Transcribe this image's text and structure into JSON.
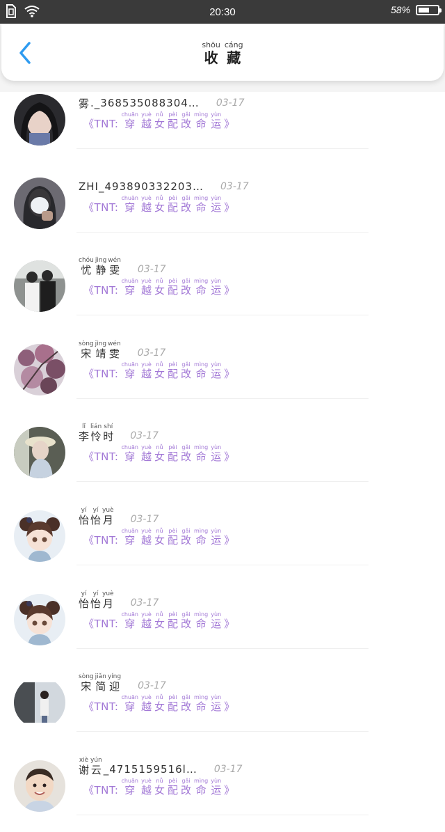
{
  "status_bar": {
    "time": "20:30",
    "battery": "58%",
    "battery_level": 0.58
  },
  "header": {
    "title": [
      {
        "py": "shōu",
        "hz": "收"
      },
      {
        "py": "cáng",
        "hz": "藏"
      }
    ]
  },
  "book": {
    "prefix": "《TNT:",
    "chars": [
      {
        "py": "chuān",
        "hz": "穿"
      },
      {
        "py": "yuè",
        "hz": "越"
      },
      {
        "py": "nǚ",
        "hz": "女"
      },
      {
        "py": "pèi",
        "hz": "配"
      },
      {
        "py": "gǎi",
        "hz": "改"
      },
      {
        "py": "mìng",
        "hz": "命"
      },
      {
        "py": "yùn",
        "hz": "运"
      }
    ],
    "suffix": "》"
  },
  "items": [
    {
      "name_chars": [
        {
          "py": "",
          "hz": "雾"
        }
      ],
      "name_plain": "._368535088304…",
      "date": "03-17",
      "avatar": "dark-hair-girl"
    },
    {
      "name_chars": [],
      "name_plain": "ZHI_493890332203…",
      "date": "03-17",
      "avatar": "masked-girl"
    },
    {
      "name_chars": [
        {
          "py": "chóu",
          "hz": "忧"
        },
        {
          "py": "jìng",
          "hz": "静"
        },
        {
          "py": "wén",
          "hz": "雯"
        }
      ],
      "name_plain": "",
      "date": "03-17",
      "avatar": "two-boys"
    },
    {
      "name_chars": [
        {
          "py": "sòng",
          "hz": "宋"
        },
        {
          "py": "jìng",
          "hz": "靖"
        },
        {
          "py": "wén",
          "hz": "雯"
        }
      ],
      "name_plain": "",
      "date": "03-17",
      "avatar": "blossom"
    },
    {
      "name_chars": [
        {
          "py": "lǐ",
          "hz": "李"
        },
        {
          "py": "lián",
          "hz": "怜"
        },
        {
          "py": "shí",
          "hz": "时"
        }
      ],
      "name_plain": "",
      "date": "03-17",
      "avatar": "hat-girl"
    },
    {
      "name_chars": [
        {
          "py": "yí",
          "hz": "怡"
        },
        {
          "py": "yí",
          "hz": "怡"
        },
        {
          "py": "yuè",
          "hz": "月"
        }
      ],
      "name_plain": "",
      "date": "03-17",
      "avatar": "anime-girl"
    },
    {
      "name_chars": [
        {
          "py": "yí",
          "hz": "怡"
        },
        {
          "py": "yí",
          "hz": "怡"
        },
        {
          "py": "yuè",
          "hz": "月"
        }
      ],
      "name_plain": "",
      "date": "03-17",
      "avatar": "anime-girl"
    },
    {
      "name_chars": [
        {
          "py": "sòng",
          "hz": "宋"
        },
        {
          "py": "jiǎn",
          "hz": "简"
        },
        {
          "py": "yíng",
          "hz": "迎"
        }
      ],
      "name_plain": "",
      "date": "03-17",
      "avatar": "street-girl"
    },
    {
      "name_chars": [
        {
          "py": "xiè",
          "hz": "谢"
        },
        {
          "py": "yún",
          "hz": "云"
        }
      ],
      "name_plain": "_4715159516l…",
      "date": "03-17",
      "avatar": "baby"
    }
  ],
  "colors": {
    "accent": "#2e9bf0",
    "book_title": "#a278d6",
    "date": "#aaaaaa"
  }
}
